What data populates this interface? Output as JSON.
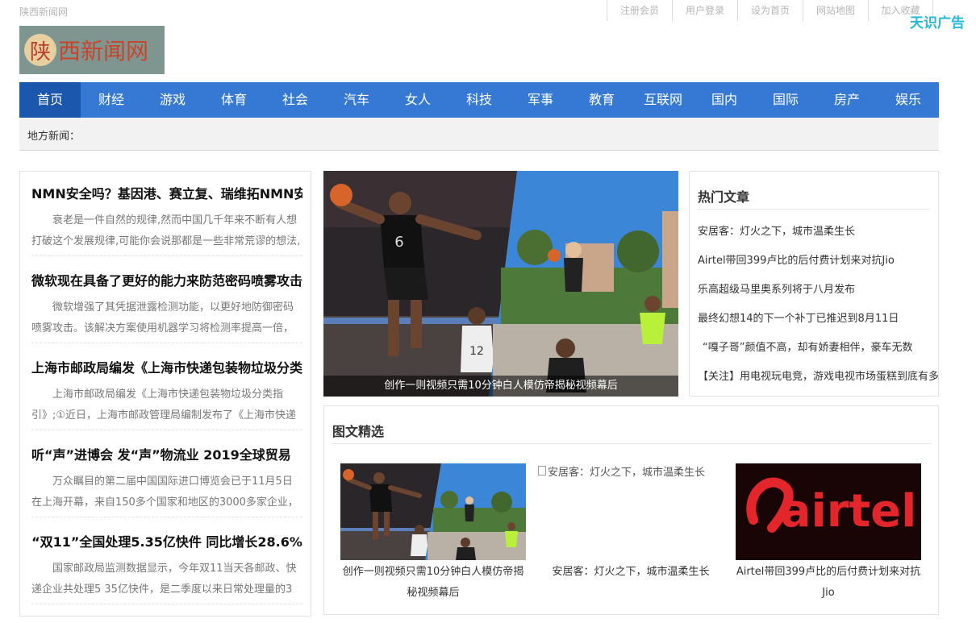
{
  "top": {
    "site_name": "陕西新闻网",
    "links": [
      "注册会员",
      "用户登录",
      "设为首页",
      "网站地图",
      "加入收藏"
    ],
    "ad_mark": "天识广告"
  },
  "logo": {
    "seal_char": "陕",
    "text": "西新闻网"
  },
  "nav": [
    "首页",
    "财经",
    "游戏",
    "体育",
    "社会",
    "汽车",
    "女人",
    "科技",
    "军事",
    "教育",
    "互联网",
    "国内",
    "国际",
    "房产",
    "娱乐"
  ],
  "local_label": "地方新闻：",
  "news": [
    {
      "title": "NMN安全吗？基因港、赛立复、瑞维拓NMN安全吗",
      "summary": "衰老是一件自然的规律,然而中国几千年来不断有人想打破这个发展规律,可能你会说那都是一些非常荒谬的想法,"
    },
    {
      "title": "微软现在具备了更好的能力来防范密码喷雾攻击",
      "summary": "微软增强了其凭据泄露检测功能，以更好地防御密码喷雾攻击。该解决方案使用机器学习将检测率提高一倍，"
    },
    {
      "title": "上海市邮政局编发《上海市快递包装物垃圾分类指引》",
      "summary": "上海市邮政局编发《上海市快递包装物垃圾分类指引》;①近日，上海市邮政管理局编制发布了《上海市快递"
    },
    {
      "title": "听“声”进博会 发“声”物流业 2019全球贸易",
      "summary": "万众瞩目的第二届中国国际进口博览会已于11月5日在上海开幕，来自150多个国家和地区的3000多家企业，其"
    },
    {
      "title": "“双11”全国处理5.35亿快件 同比增长28.6%",
      "summary": "国家邮政局监测数据显示，今年双11当天各邮政、快递企业共处理5 35亿快件，是二季度以来日常处理量的3"
    }
  ],
  "focus": {
    "caption": "创作一则视频只需10分钟白人模仿帝揭秘视频幕后",
    "jersey_left": "6",
    "jersey_right": "12"
  },
  "hot": {
    "title": "热门文章",
    "items": [
      "安居客：灯火之下，城市温柔生长",
      "Airtel带回399卢比的后付费计划来对抗Jio",
      "乐高超级马里奥系列将于八月发布",
      "最终幻想14的下一个补丁已推迟到8月11日",
      "“嘎子哥”颜值不高，却有娇妻相伴，豪车无数",
      "【关注】用电视玩电竞，游戏电视市场蛋糕到底有多大"
    ]
  },
  "pics": {
    "title": "图文精选",
    "items": [
      {
        "caption": "创作一则视频只需10分钟白人模仿帝揭秘视频幕后"
      },
      {
        "caption": "安居客：灯火之下，城市温柔生长",
        "alt": "安居客：灯火之下，城市温柔生长"
      },
      {
        "caption": "Airtel带回399卢比的后付费计划来对抗Jio",
        "logo_text": "airtel"
      }
    ]
  },
  "colors": {
    "nav_bg": "#3679d5",
    "nav_active": "#1b57ad",
    "ad_mark": "#2ab7d6",
    "airtel_red": "#e3262b"
  }
}
